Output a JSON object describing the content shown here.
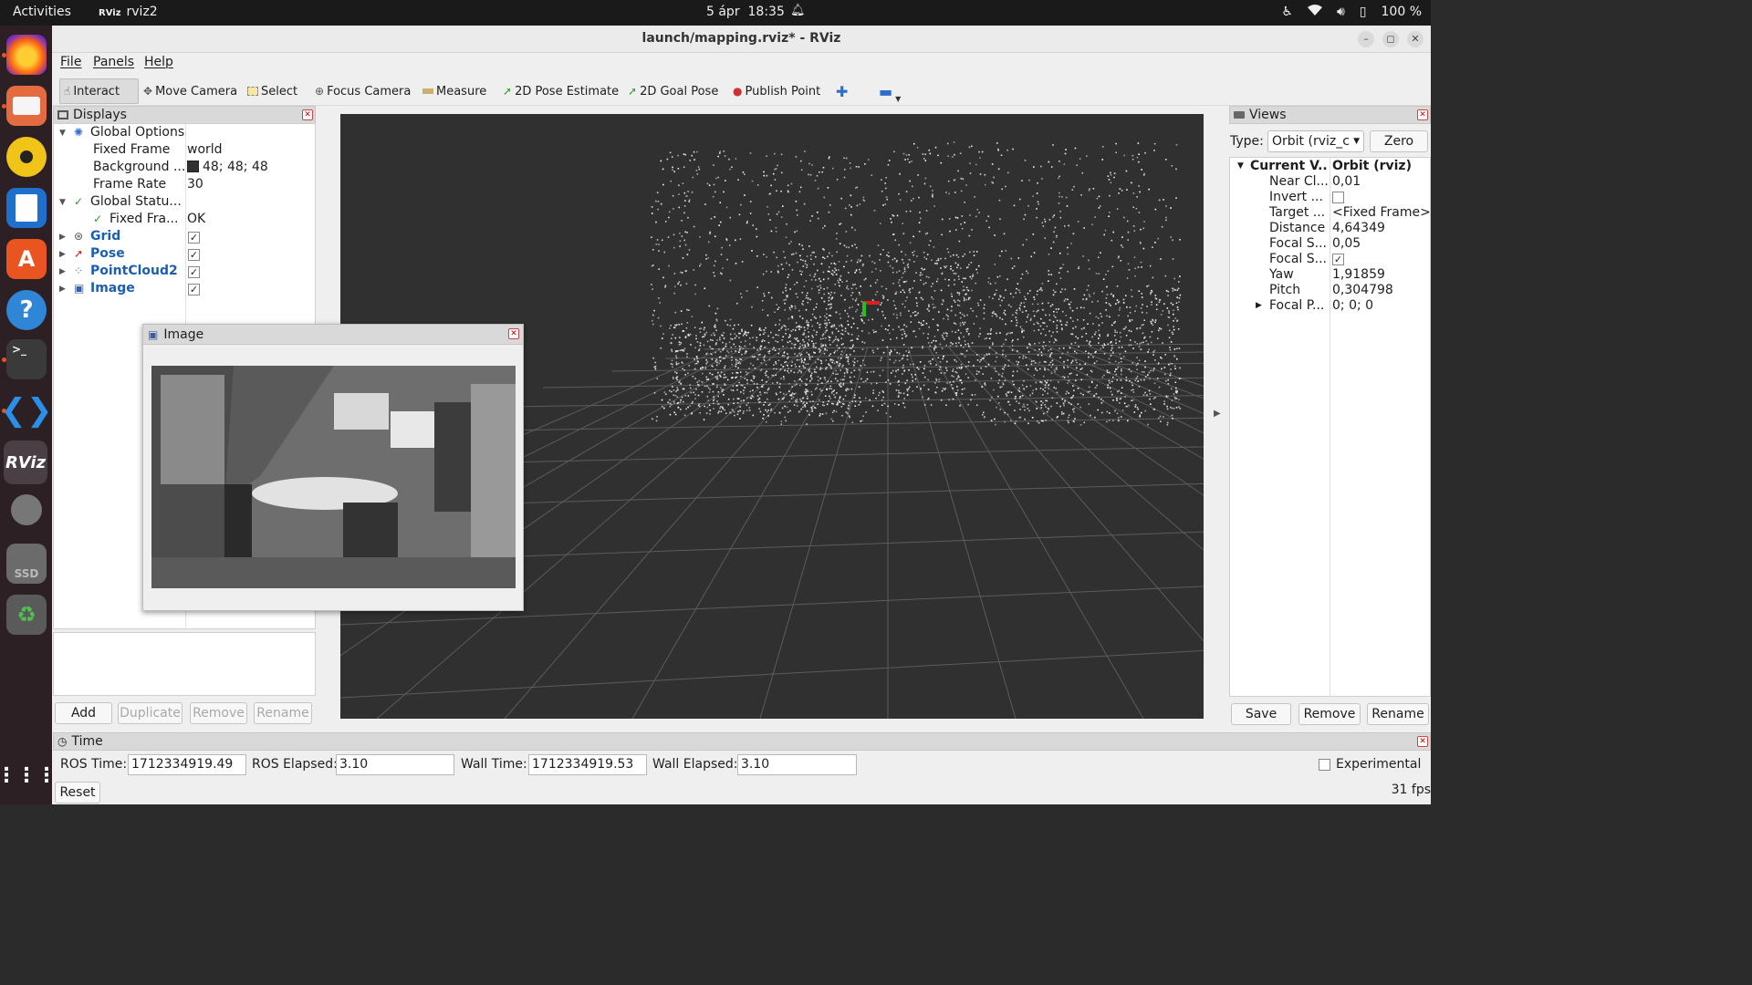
{
  "topbar": {
    "activities": "Activities",
    "app_logo": "RViz",
    "app_name": "rviz2",
    "date": "5 ápr",
    "time": "18:35",
    "battery": "100 %"
  },
  "window": {
    "title": "launch/mapping.rviz* - RViz"
  },
  "menu": {
    "file": "File",
    "panels": "Panels",
    "help": "Help"
  },
  "toolbar": {
    "interact": "Interact",
    "move_camera": "Move Camera",
    "select": "Select",
    "focus_camera": "Focus Camera",
    "measure": "Measure",
    "pose_estimate": "2D Pose Estimate",
    "goal_pose": "2D Goal Pose",
    "publish_point": "Publish Point"
  },
  "displays": {
    "title": "Displays",
    "global_options": "Global Options",
    "fixed_frame_label": "Fixed Frame",
    "fixed_frame_value": "world",
    "background_label": "Background ...",
    "background_value": "48; 48; 48",
    "background_color": "#303030",
    "frame_rate_label": "Frame Rate",
    "frame_rate_value": "30",
    "global_status": "Global Statu...",
    "fixed_frame_status_label": "Fixed Fra...",
    "fixed_frame_status_value": "OK",
    "items": [
      {
        "name": "Grid",
        "checked": true
      },
      {
        "name": "Pose",
        "checked": true
      },
      {
        "name": "PointCloud2",
        "checked": true
      },
      {
        "name": "Image",
        "checked": true
      }
    ],
    "buttons": {
      "add": "Add",
      "duplicate": "Duplicate",
      "remove": "Remove",
      "rename": "Rename"
    }
  },
  "image_panel": {
    "title": "Image"
  },
  "views": {
    "title": "Views",
    "type_label": "Type:",
    "type_value": "Orbit (rviz_c",
    "zero": "Zero",
    "current_label": "Current V...",
    "current_value": "Orbit (rviz)",
    "rows": [
      {
        "name": "Near Cl...",
        "value": "0,01"
      },
      {
        "name": "Invert ...",
        "value": ""
      },
      {
        "name": "Target ...",
        "value": "<Fixed Frame>"
      },
      {
        "name": "Distance",
        "value": "4,64349"
      },
      {
        "name": "Focal S...",
        "value": "0,05"
      },
      {
        "name": "Focal S...",
        "value": ""
      },
      {
        "name": "Yaw",
        "value": "1,91859"
      },
      {
        "name": "Pitch",
        "value": "0,304798"
      },
      {
        "name": "Focal P...",
        "value": "0; 0; 0"
      }
    ],
    "buttons": {
      "save": "Save",
      "remove": "Remove",
      "rename": "Rename"
    }
  },
  "time": {
    "title": "Time",
    "ros_time_label": "ROS Time:",
    "ros_time_value": "1712334919.49",
    "ros_elapsed_label": "ROS Elapsed:",
    "ros_elapsed_value": "3.10",
    "wall_time_label": "Wall Time:",
    "wall_time_value": "1712334919.53",
    "wall_elapsed_label": "Wall Elapsed:",
    "wall_elapsed_value": "3.10",
    "experimental": "Experimental",
    "reset": "Reset",
    "fps": "31 fps"
  },
  "dock": {
    "ssd_label": "SSD",
    "terminal_prompt": ">_",
    "rviz_label": "RViz"
  }
}
